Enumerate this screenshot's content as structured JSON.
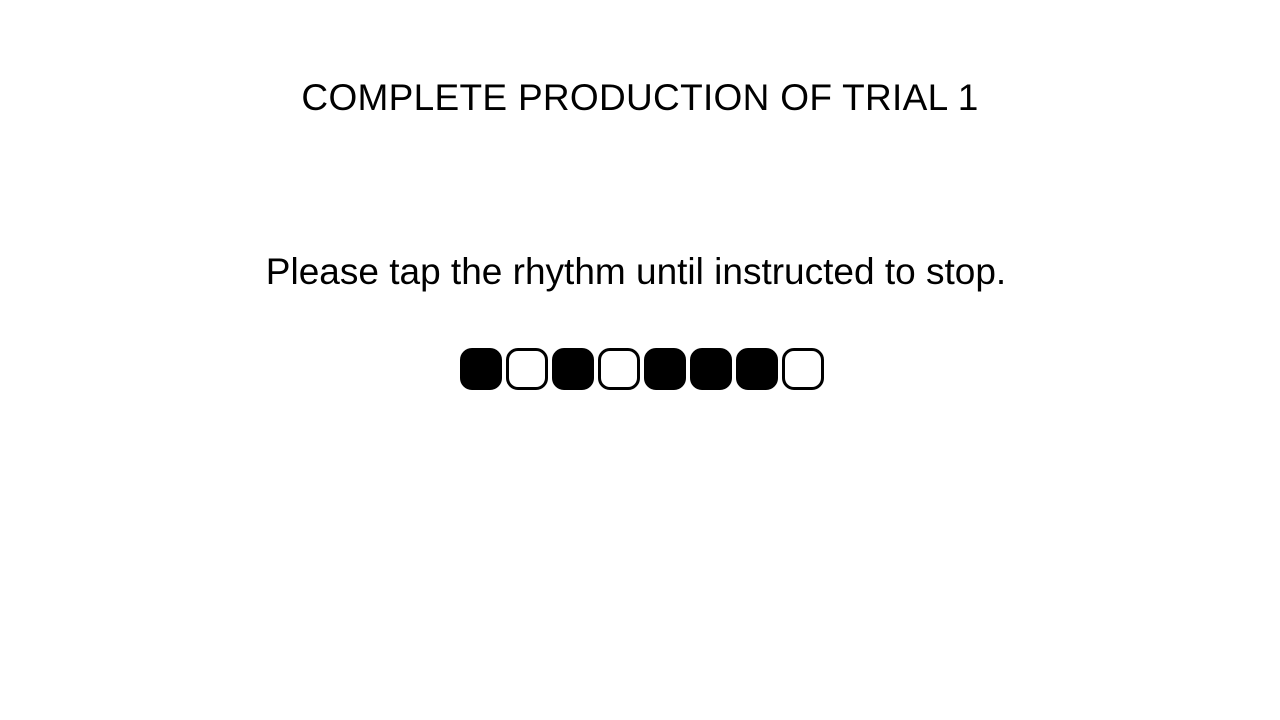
{
  "screen": {
    "heading": "COMPLETE PRODUCTION OF TRIAL 1",
    "instruction": "Please tap the rhythm until instructed to stop."
  },
  "rhythm": {
    "pattern": [
      1,
      0,
      1,
      0,
      1,
      1,
      1,
      0
    ],
    "filled_color": "#000000",
    "empty_color": "#ffffff"
  }
}
